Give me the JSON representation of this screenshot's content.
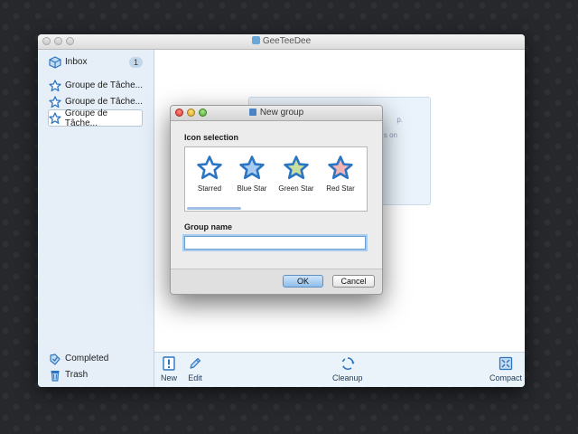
{
  "window": {
    "title": "GeeTeeDee"
  },
  "sidebar": {
    "inbox": {
      "label": "Inbox",
      "count": "1"
    },
    "groups": [
      {
        "label": "Groupe de Tâche..."
      },
      {
        "label": "Groupe de Tâche..."
      },
      {
        "label": "Groupe de Tâche..."
      }
    ],
    "completed": {
      "label": "Completed"
    },
    "trash": {
      "label": "Trash"
    }
  },
  "background_panel": {
    "line1": "p.",
    "line2": "s on"
  },
  "toolbar": {
    "new_label": "New",
    "edit_label": "Edit",
    "cleanup_label": "Cleanup",
    "compact_label": "Compact"
  },
  "dialog": {
    "title": "New group",
    "icon_selection_label": "Icon selection",
    "icons": [
      {
        "label": "Starred",
        "icon": "star-outline-icon",
        "fill": "#ffffff"
      },
      {
        "label": "Blue Star",
        "icon": "blue-star-icon",
        "fill": "#a8cbef"
      },
      {
        "label": "Green Star",
        "icon": "green-star-icon",
        "fill": "#c8dfa0"
      },
      {
        "label": "Red Star",
        "icon": "red-star-icon",
        "fill": "#f1b3b3"
      }
    ],
    "group_name_label": "Group name",
    "group_name_value": "",
    "ok_label": "OK",
    "cancel_label": "Cancel"
  },
  "colors": {
    "star_stroke": "#2b75c2",
    "accent": "#6b9fd2",
    "sidebar_bg": "#e6eff8"
  }
}
